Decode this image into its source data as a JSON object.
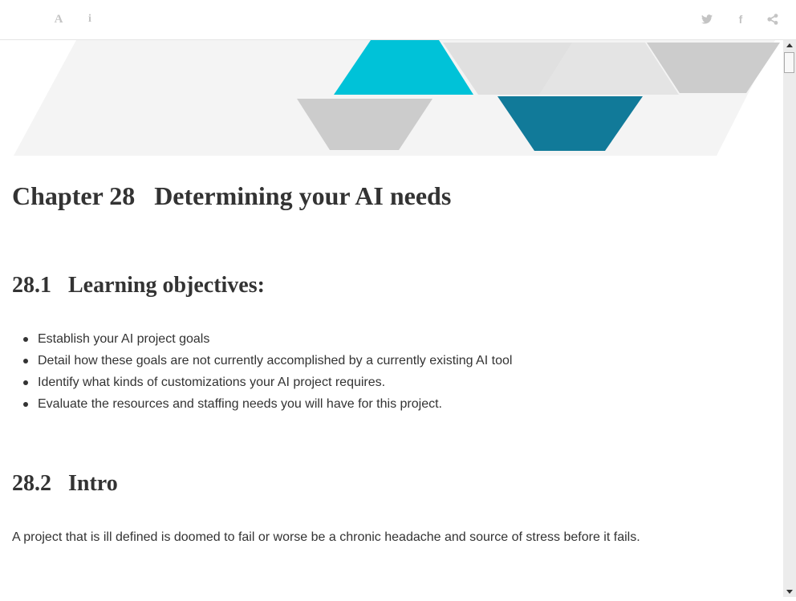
{
  "toolbar": {
    "icons": [
      "font-settings-icon",
      "info-icon",
      "twitter-icon",
      "facebook-icon",
      "share-icon"
    ],
    "font_glyph": "A",
    "info_glyph": "i",
    "facebook_glyph": "f"
  },
  "colors": {
    "text": "#333333",
    "toolbar_icon": "#c4c4c4",
    "banner_cyan": "#00c2d8",
    "banner_teal": "#117a99",
    "banner_gray": "#cccccc",
    "banner_light": "#f4f4f4"
  },
  "chapter": {
    "number": "Chapter 28",
    "title": "Determining your AI needs"
  },
  "sections": [
    {
      "number": "28.1",
      "title": "Learning objectives:"
    },
    {
      "number": "28.2",
      "title": "Intro"
    }
  ],
  "objectives": [
    "Establish your AI project goals",
    "Detail how these goals are not currently accomplished by a currently existing AI tool",
    "Identify what kinds of customizations your AI project requires.",
    "Evaluate the resources and staffing needs you will have for this project."
  ],
  "intro": {
    "paragraph": "A project that is ill defined is doomed to fail or worse be a chronic headache and source of stress before it fails."
  }
}
